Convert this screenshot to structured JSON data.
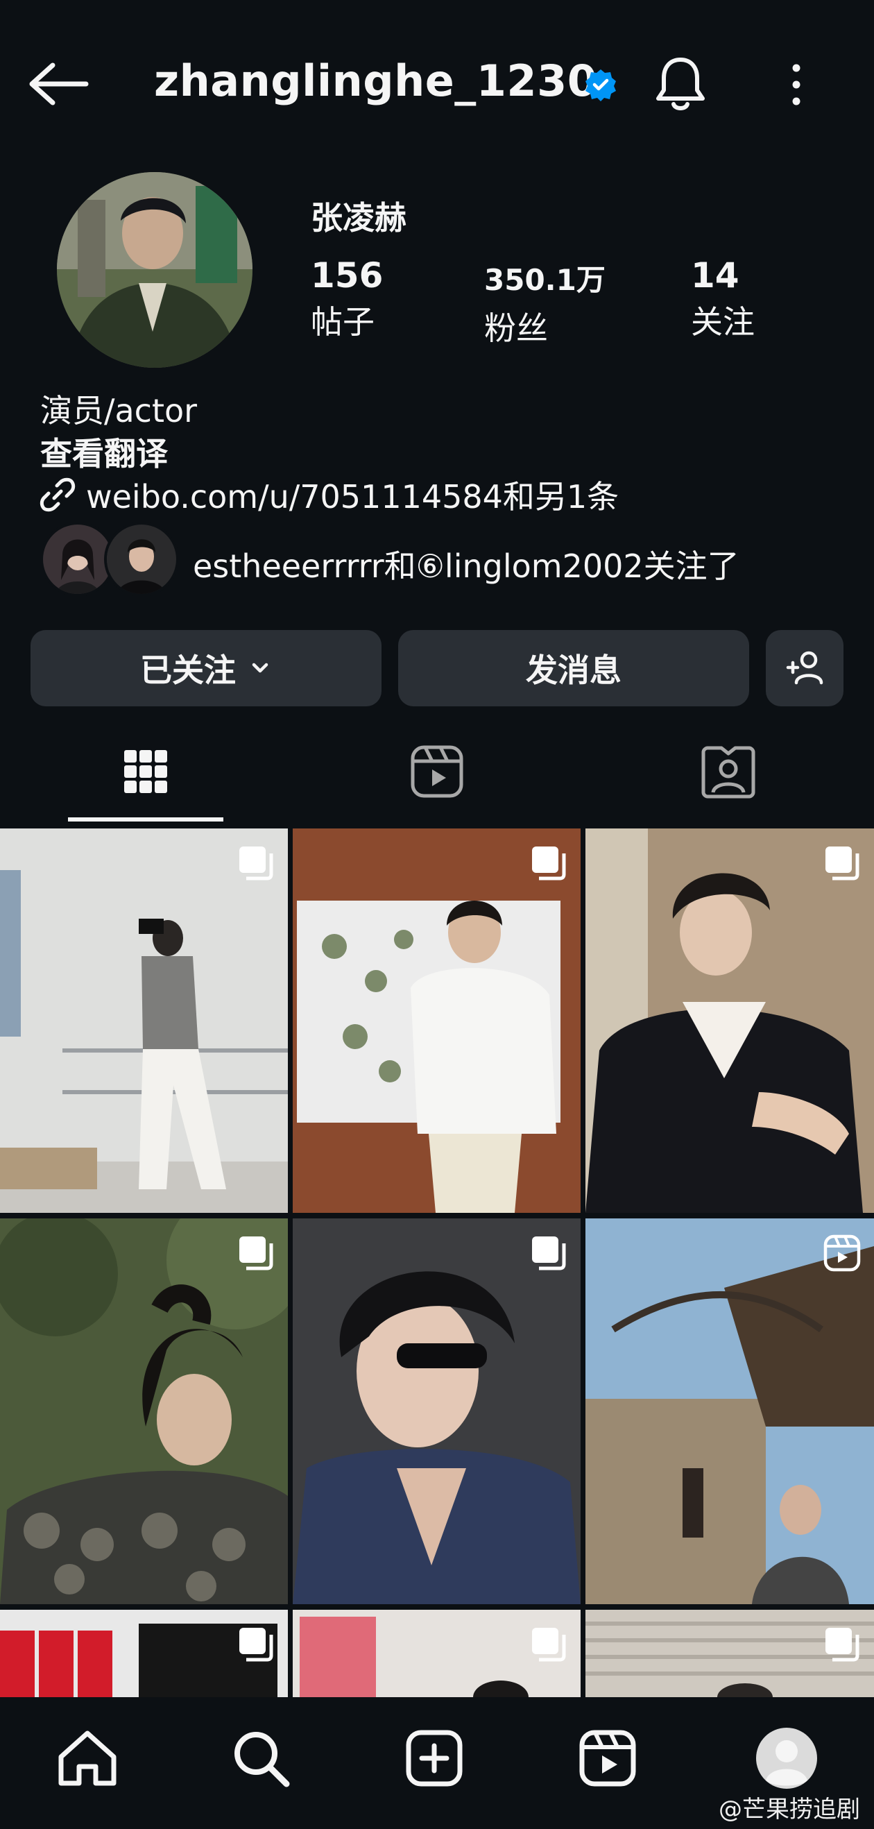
{
  "header": {
    "username": "zhanglinghe_1230",
    "icons": [
      "back-arrow-icon",
      "verified-badge-icon",
      "bell-icon",
      "more-vertical-icon"
    ]
  },
  "profile": {
    "display_name": "张凌赫",
    "stats": [
      {
        "value": "156",
        "label": "帖子"
      },
      {
        "value": "350.1万",
        "label": "粉丝"
      },
      {
        "value": "14",
        "label": "关注"
      }
    ],
    "bio": "演员/actor",
    "translate": "查看翻译",
    "link": "weibo.com/u/7051114584和另1条",
    "followed_by": "estheeerrrrr和⑥linglom2002关注了"
  },
  "actions": {
    "following": "已关注",
    "message": "发消息"
  },
  "tabs": [
    "posts-grid-icon",
    "reels-icon",
    "tagged-icon"
  ],
  "grid_icons": [
    "multi-post-icon",
    "multi-post-icon",
    "multi-post-icon",
    "multi-post-icon",
    "multi-post-icon",
    "reel-icon",
    "multi-post-icon",
    "multi-post-icon",
    "multi-post-icon"
  ],
  "bottom_nav": [
    "home-icon",
    "search-icon",
    "create-icon",
    "reels-icon",
    "profile-icon"
  ],
  "watermark": "@芒果捞追剧",
  "colors": {
    "background": "#0c1014",
    "button": "#2a2f35",
    "verified": "#0095f6"
  }
}
